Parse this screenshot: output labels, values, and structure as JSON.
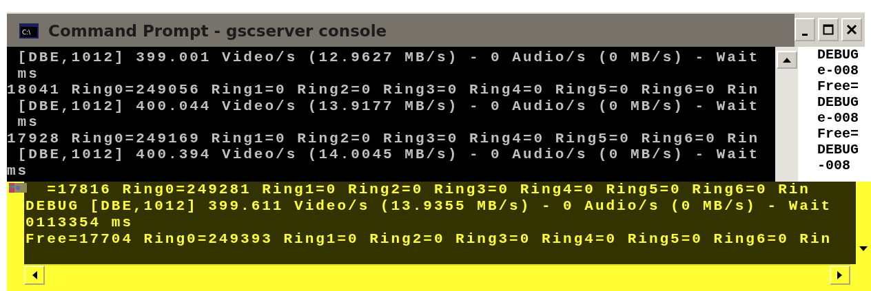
{
  "window": {
    "title": "Command Prompt - gscserver console",
    "icon_text": "C:\\"
  },
  "console_lines": [
    " [DBE,1012] 399.001 Video/s (12.9627 MB/s) - 0 Audio/s (0 MB/s) - Wait",
    " ms",
    "18041 Ring0=249056 Ring1=0 Ring2=0 Ring3=0 Ring4=0 Ring5=0 Ring6=0 Rin",
    " [DBE,1012] 400.044 Video/s (13.9177 MB/s) - 0 Audio/s (0 MB/s) - Wait",
    " ms",
    "17928 Ring0=249169 Ring1=0 Ring2=0 Ring3=0 Ring4=0 Ring5=0 Ring6=0 Rin",
    " [DBE,1012] 400.394 Video/s (14.0045 MB/s) - 0 Audio/s (0 MB/s) - Wait",
    "ms"
  ],
  "side_window": {
    "lines": [
      "DEBUG",
      "e-008",
      "Free=",
      "DEBUG",
      "e-008",
      "Free=",
      "DEBUG",
      "-008"
    ]
  },
  "highlighted_window": {
    "lines": [
      "  =17816 Ring0=249281 Ring1=0 Ring2=0 Ring3=0 Ring4=0 Ring5=0 Ring6=0 Rin",
      "DEBUG [DBE,1012] 399.611 Video/s (13.9355 MB/s) - 0 Audio/s (0 MB/s) - Wait",
      "0113354 ms",
      "Free=17704 Ring0=249393 Ring1=0 Ring2=0 Ring3=0 Ring4=0 Ring5=0 Ring6=0 Rin"
    ]
  }
}
